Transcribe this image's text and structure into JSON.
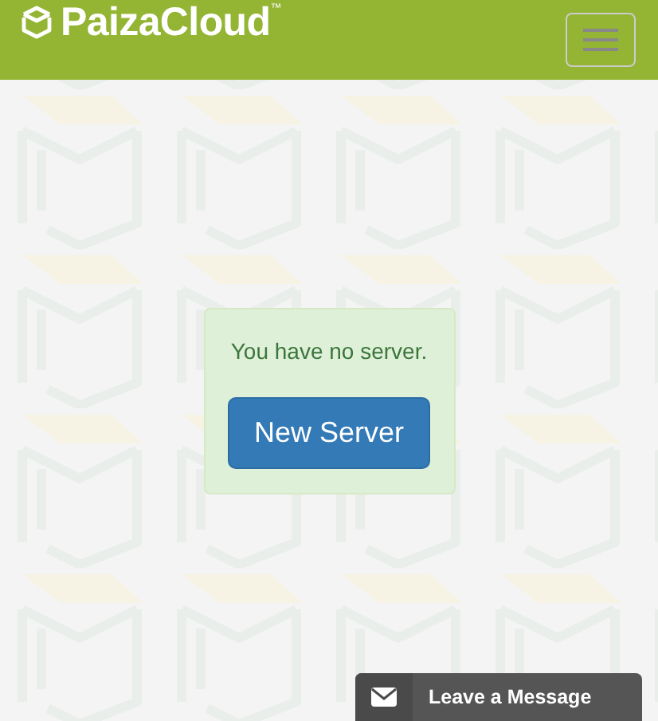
{
  "navbar": {
    "brand": "PaizaCloud",
    "brand_mark": "™"
  },
  "alert": {
    "message": "You have no server.",
    "button": "New Server"
  },
  "chat_widget": {
    "label": "Leave a Message"
  }
}
